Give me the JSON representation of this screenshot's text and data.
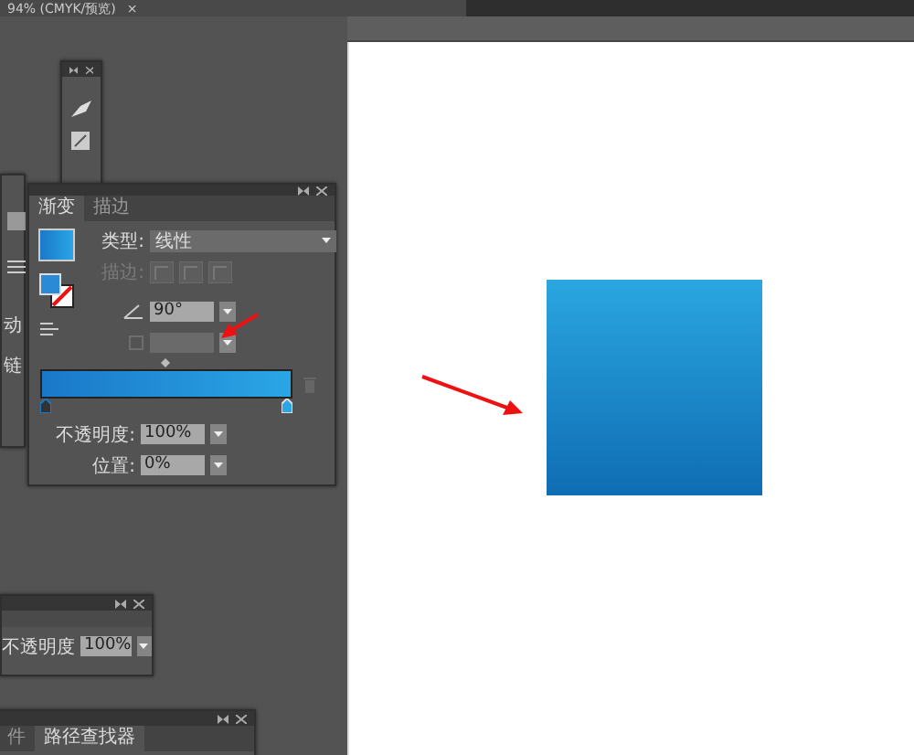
{
  "document_tab": {
    "title": "94% (CMYK/预览)",
    "close": "×"
  },
  "side_panel": {
    "labels": [
      "动",
      "链"
    ]
  },
  "gradient_panel": {
    "tabs": [
      {
        "label": "渐变",
        "selected": true
      },
      {
        "label": "描边",
        "selected": false
      }
    ],
    "type_label": "类型:",
    "type_value": "线性",
    "stroke_label": "描边:",
    "angle_value": "90°",
    "opacity_label": "不透明度:",
    "opacity_value": "100%",
    "location_label": "位置:",
    "location_value": "0%"
  },
  "transparency_panel": {
    "opacity_label": "不透明度",
    "opacity_value": "100%"
  },
  "pathfinder_panel": {
    "tabs": [
      {
        "label": "件",
        "selected": false
      },
      {
        "label": "路径查找器",
        "selected": true
      }
    ]
  }
}
